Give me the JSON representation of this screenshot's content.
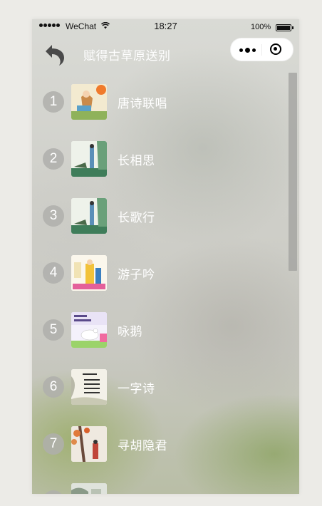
{
  "statusbar": {
    "carrier": "WeChat",
    "time": "18:27",
    "battery": "100%"
  },
  "navbar": {
    "title": "赋得古草原送别"
  },
  "poems": [
    {
      "number": "1",
      "title": "唐诗联唱"
    },
    {
      "number": "2",
      "title": "长相思"
    },
    {
      "number": "3",
      "title": "长歌行"
    },
    {
      "number": "4",
      "title": "游子吟"
    },
    {
      "number": "5",
      "title": "咏鹅"
    },
    {
      "number": "6",
      "title": "一字诗"
    },
    {
      "number": "7",
      "title": "寻胡隐君"
    }
  ]
}
